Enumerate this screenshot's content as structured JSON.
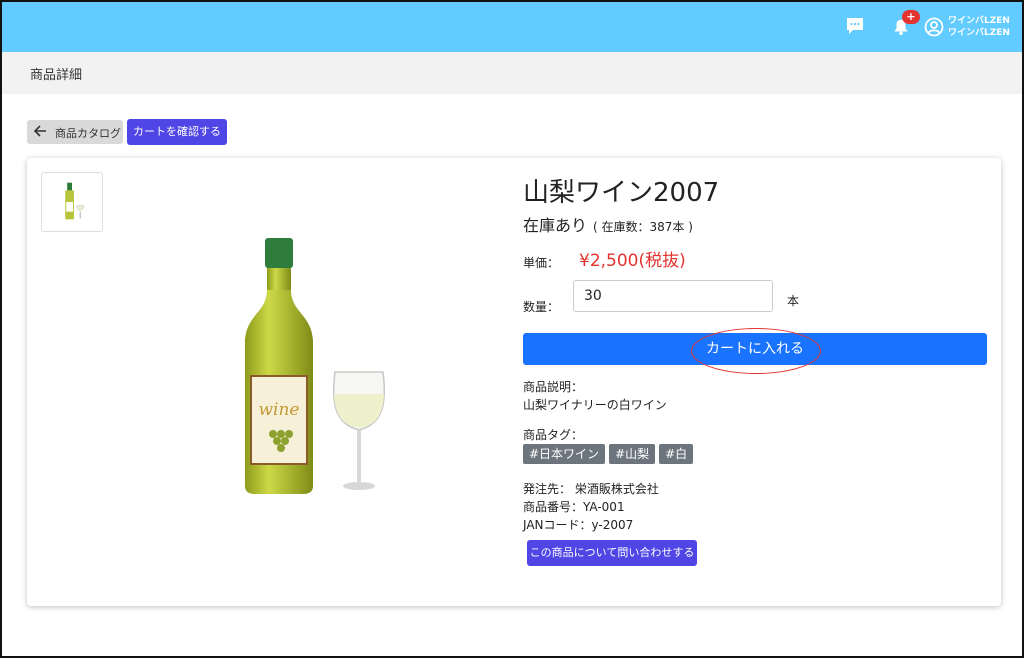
{
  "header": {
    "badge": "+",
    "user_line1": "ワインバLZEN",
    "user_line2": "ワインバLZEN"
  },
  "subheader": {
    "title": "商品詳細"
  },
  "nav": {
    "back_label": "商品カタログ",
    "cart_check_label": "カートを確認する"
  },
  "product": {
    "name": "山梨ワイン2007",
    "stock_status": "在庫あり",
    "stock_count": "( 在庫数：387本 )",
    "price_label": "単価：",
    "price": "¥2,500(税抜)",
    "qty_label": "数量：",
    "qty_value": "30",
    "qty_unit": "本",
    "add_to_cart": "カートに入れる",
    "desc_label": "商品説明：",
    "description": "山梨ワイナリーの白ワイン",
    "tags_label": "商品タグ：",
    "tags": [
      "#日本ワイン",
      "#山梨",
      "#白"
    ],
    "supplier": "発注先： 栄酒販株式会社",
    "product_code": "商品番号：YA-001",
    "jan_code": "JANコード：y-2007",
    "inquiry": "この商品について問い合わせする",
    "label_text": "wine"
  },
  "colors": {
    "topbar": "#62cbff",
    "primary": "#1a73ff",
    "indigo": "#4f46e5",
    "price": "#e3342f",
    "tag": "#6c757d"
  }
}
